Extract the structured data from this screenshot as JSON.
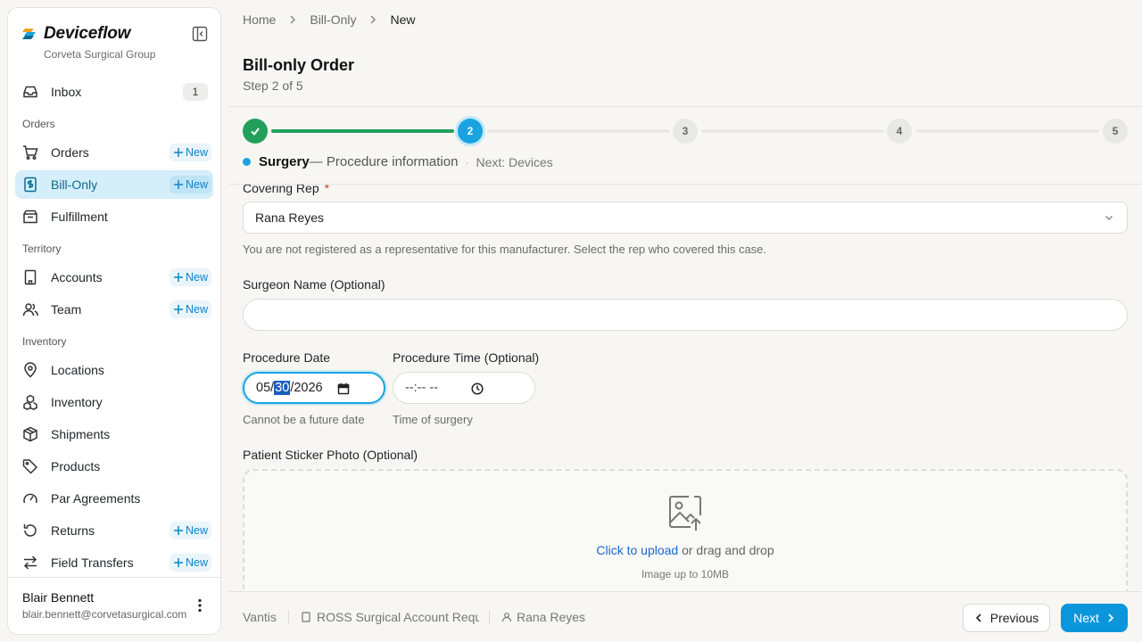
{
  "brand": {
    "name": "Deviceflow",
    "org": "Corveta Surgical Group"
  },
  "sidebar": {
    "inbox": {
      "label": "Inbox",
      "count": "1"
    },
    "sections": {
      "orders": "Orders",
      "territory": "Territory",
      "inventory": "Inventory"
    },
    "items": {
      "orders": "Orders",
      "bill_only": "Bill-Only",
      "fulfillment": "Fulfillment",
      "accounts": "Accounts",
      "team": "Team",
      "locations": "Locations",
      "inventory": "Inventory",
      "shipments": "Shipments",
      "products": "Products",
      "par_agreements": "Par Agreements",
      "returns": "Returns",
      "field_transfers": "Field Transfers"
    },
    "new_label": "New"
  },
  "user": {
    "name": "Blair Bennett",
    "email": "blair.bennett@corvetasurgical.com"
  },
  "breadcrumb": {
    "home": "Home",
    "section": "Bill-Only",
    "current": "New"
  },
  "page": {
    "title": "Bill-only Order",
    "subtitle": "Step 2 of 5"
  },
  "stepper": {
    "steps": [
      "1",
      "2",
      "3",
      "4",
      "5"
    ],
    "current_step": 2,
    "current_name": "Surgery",
    "current_desc": "— Procedure information",
    "separator": "·",
    "next": "Next: Devices"
  },
  "form": {
    "covering_rep": {
      "label": "Covering Rep",
      "required": "*",
      "value": "Rana Reyes",
      "help": "You are not registered as a representative for this manufacturer. Select the rep who covered this case."
    },
    "surgeon": {
      "label": "Surgeon Name (Optional)",
      "value": ""
    },
    "procedure_date": {
      "label": "Procedure Date",
      "month": "05",
      "day": "30",
      "year": "2026",
      "help": "Cannot be a future date"
    },
    "procedure_time": {
      "label": "Procedure Time (Optional)",
      "value": "--:-- --",
      "help": "Time of surgery"
    },
    "sticker": {
      "label": "Patient Sticker Photo (Optional)",
      "link": "Click to upload",
      "text": " or drag and drop",
      "sub": "Image up to 10MB"
    }
  },
  "footer": {
    "manufacturer": "Vantis",
    "account": "ROSS Surgical Account Requ",
    "rep": "Rana Reyes",
    "previous": "Previous",
    "next": "Next"
  },
  "colors": {
    "accent": "#0b96dc",
    "success": "#22a05a",
    "active_bg": "#d4eefa",
    "link": "#1a66d2",
    "required": "#e0312e"
  },
  "icons": [
    "deviceflow-logo-icon",
    "sidebar-collapse-icon",
    "inbox-icon",
    "cart-icon",
    "receipt-icon",
    "package-open-icon",
    "building-icon",
    "users-icon",
    "map-pin-icon",
    "boxes-icon",
    "package-icon",
    "tag-icon",
    "gauge-icon",
    "undo-icon",
    "arrows-icon",
    "more-vertical-icon",
    "chevron-right-icon",
    "check-icon",
    "chevron-down-icon",
    "calendar-icon",
    "clock-icon",
    "image-upload-icon",
    "chevron-left-icon",
    "user-icon"
  ]
}
